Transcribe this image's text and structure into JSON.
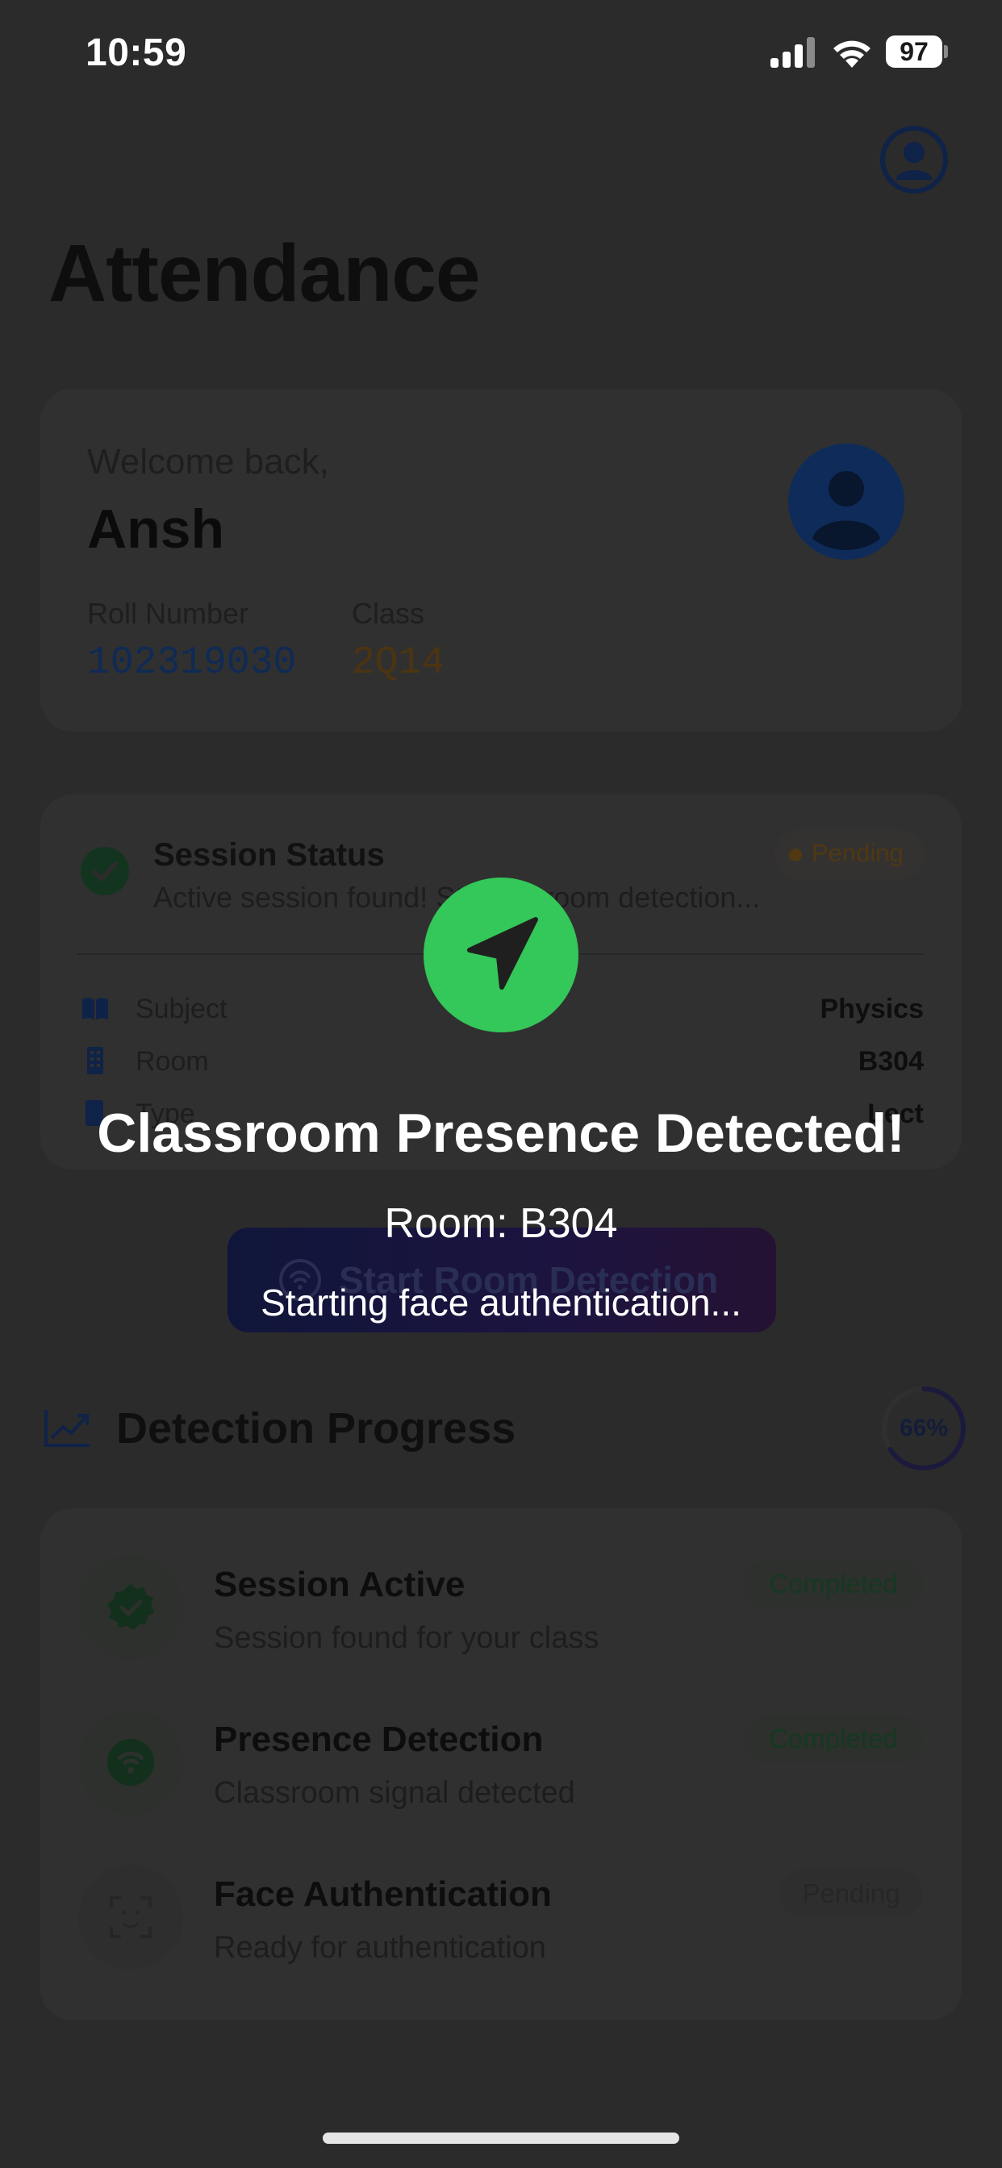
{
  "status_bar": {
    "time": "10:59",
    "battery": "97"
  },
  "header": {
    "title": "Attendance"
  },
  "welcome": {
    "greeting": "Welcome back,",
    "name": "Ansh",
    "roll_label": "Roll Number",
    "roll_value": "102319030",
    "class_label": "Class",
    "class_value": "2Q14"
  },
  "session": {
    "title": "Session Status",
    "subtitle": "Active session found! Starting room detection...",
    "status": "Pending",
    "rows": [
      {
        "icon": "book-icon",
        "label": "Subject",
        "value": "Physics"
      },
      {
        "icon": "building-icon",
        "label": "Room",
        "value": "B304"
      },
      {
        "icon": "tag-icon",
        "label": "Type",
        "value": "Lect"
      }
    ]
  },
  "detect_button": {
    "label": "Start Room Detection"
  },
  "progress": {
    "title": "Detection Progress",
    "percent_label": "66%",
    "percent": 66,
    "steps": [
      {
        "icon": "verified-badge-icon",
        "title": "Session Active",
        "subtitle": "Session found for your class",
        "status": "Completed"
      },
      {
        "icon": "wifi-signal-icon",
        "title": "Presence Detection",
        "subtitle": "Classroom signal detected",
        "status": "Completed"
      },
      {
        "icon": "face-scan-icon",
        "title": "Face Authentication",
        "subtitle": "Ready for authentication",
        "status": "Pending"
      }
    ]
  },
  "overlay": {
    "title": "Classroom Presence Detected!",
    "room": "Room: B304",
    "message": "Starting face authentication..."
  },
  "colors": {
    "accent_green": "#34c759",
    "background": "#2b2b2b"
  }
}
